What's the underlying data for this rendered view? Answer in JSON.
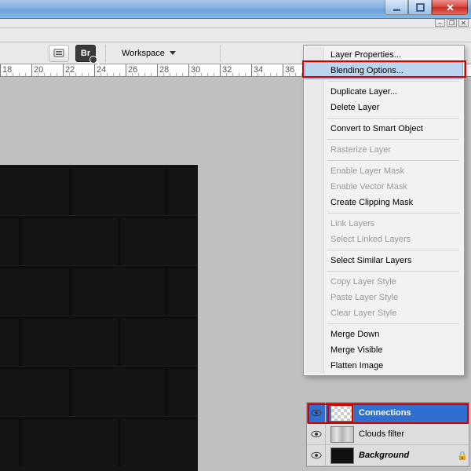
{
  "window_controls": {
    "min": "–",
    "max": "☐",
    "close": "✕"
  },
  "app_controls": {
    "min": "–",
    "restore": "❐",
    "close": "✕"
  },
  "toolbar": {
    "bridge_label": "Br",
    "workspace_label": "Workspace"
  },
  "ruler": {
    "labels": [
      "18",
      "20",
      "22",
      "24",
      "26",
      "28",
      "30",
      "32",
      "34",
      "36"
    ]
  },
  "context_menu": {
    "items": [
      {
        "label": "Layer Properties...",
        "enabled": true
      },
      {
        "label": "Blending Options...",
        "enabled": true,
        "hover": true
      },
      {
        "sep": true
      },
      {
        "label": "Duplicate Layer...",
        "enabled": true
      },
      {
        "label": "Delete Layer",
        "enabled": true
      },
      {
        "sep": true
      },
      {
        "label": "Convert to Smart Object",
        "enabled": true
      },
      {
        "sep": true
      },
      {
        "label": "Rasterize Layer",
        "enabled": false
      },
      {
        "sep": true
      },
      {
        "label": "Enable Layer Mask",
        "enabled": false
      },
      {
        "label": "Enable Vector Mask",
        "enabled": false
      },
      {
        "label": "Create Clipping Mask",
        "enabled": true
      },
      {
        "sep": true
      },
      {
        "label": "Link Layers",
        "enabled": false
      },
      {
        "label": "Select Linked Layers",
        "enabled": false
      },
      {
        "sep": true
      },
      {
        "label": "Select Similar Layers",
        "enabled": true
      },
      {
        "sep": true
      },
      {
        "label": "Copy Layer Style",
        "enabled": false
      },
      {
        "label": "Paste Layer Style",
        "enabled": false
      },
      {
        "label": "Clear Layer Style",
        "enabled": false
      },
      {
        "sep": true
      },
      {
        "label": "Merge Down",
        "enabled": true
      },
      {
        "label": "Merge Visible",
        "enabled": true
      },
      {
        "label": "Flatten Image",
        "enabled": true
      }
    ]
  },
  "layers_panel": {
    "rows": [
      {
        "name": "Connections",
        "thumb": "checker",
        "selected": true,
        "locked": false,
        "bold": false
      },
      {
        "name": "Clouds filter",
        "thumb": "clouds",
        "selected": false,
        "locked": false,
        "bold": false
      },
      {
        "name": "Background",
        "thumb": "dark",
        "selected": false,
        "locked": true,
        "bold": true
      }
    ]
  }
}
